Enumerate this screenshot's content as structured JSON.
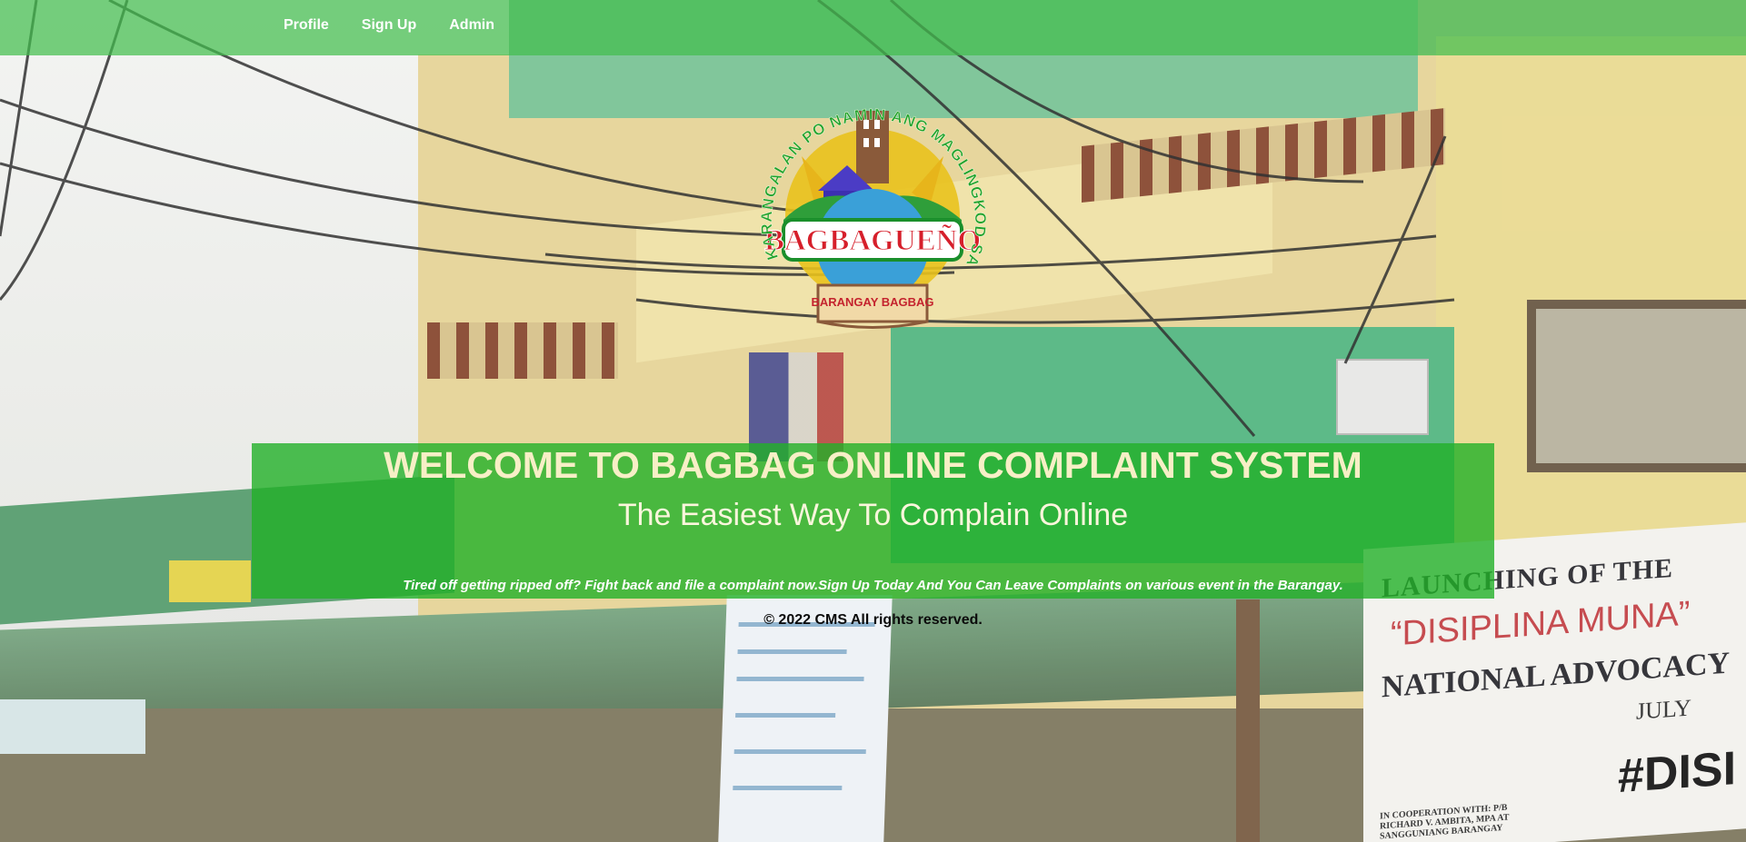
{
  "nav": {
    "items": [
      {
        "label": "Profile"
      },
      {
        "label": "Sign Up"
      },
      {
        "label": "Admin"
      }
    ]
  },
  "logo": {
    "arc_text": "KARANGALAN PO NAMIN ANG MAGLINGKOD SA INYO",
    "name": "BAGBAGUEÑO",
    "sub": "BARANGAY BAGBAG"
  },
  "hero": {
    "title": "WELCOME TO BAGBAG ONLINE COMPLAINT SYSTEM",
    "subtitle": "The Easiest Way To Complain Online",
    "description": "Tired off getting ripped off? Fight back and file a complaint now.Sign Up Today And You Can Leave Complaints on various event in the Barangay."
  },
  "footer": {
    "copyright": "© 2022 CMS All rights reserved."
  },
  "background_banner": {
    "line1": "LAUNCHING OF THE",
    "line2": "“DISIPLINA MUNA”",
    "line3": "NATIONAL ADVOCACY",
    "line4": "JULY",
    "line5": "#DISI",
    "line6": "IN COOPERATION WITH: P/B RICHARD V. AMBITA, MPA AT SANGGUNIANG BARANGAY"
  },
  "colors": {
    "navbar": "#43be4e",
    "hero_panel": "#22b028",
    "title_text": "#f7efc6"
  }
}
